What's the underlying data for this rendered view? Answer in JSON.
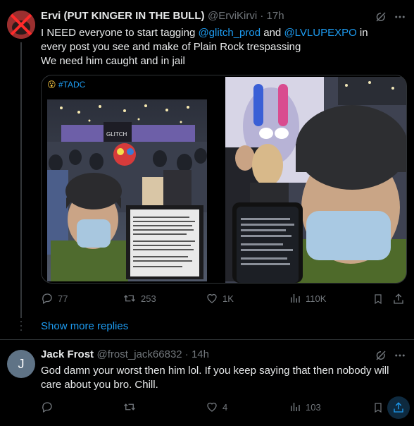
{
  "tweet1": {
    "display_name": "Ervi (PUT KINGER IN THE BULL)",
    "handle_time": "@ErviKirvi · 17h",
    "text_before": "I NEED everyone to start tagging ",
    "mention1": "@glitch_prod",
    "text_and": " and ",
    "mention2": "@LVLUPEXPO",
    "text_after": " in every post you see and make of Plain Rock trespassing",
    "line2": "We need him caught and in jail",
    "media_tag": "#TADC",
    "media_tag_emoji": "😮",
    "stats": {
      "replies": "77",
      "reposts": "253",
      "likes": "1K",
      "views": "110K"
    }
  },
  "show_more": "Show more replies",
  "tweet2": {
    "avatar_letter": "J",
    "display_name": "Jack Frost",
    "handle_time": "@frost_jack66832 · 14h",
    "text": "God damn your worst then him lol. If you keep saying that then nobody will care about you bro. Chill.",
    "stats": {
      "replies": "",
      "reposts": "",
      "likes": "4",
      "views": "103"
    }
  },
  "photo_left": {
    "sign_text": "GLITCH"
  },
  "colors": {
    "accent": "#1d9bf0",
    "muted": "#71767b",
    "text": "#e7e9ea",
    "divider": "#2f3336"
  },
  "icons": [
    "grok-icon",
    "more-icon",
    "reply-icon",
    "repost-icon",
    "like-icon",
    "views-icon",
    "bookmark-icon",
    "share-icon"
  ]
}
